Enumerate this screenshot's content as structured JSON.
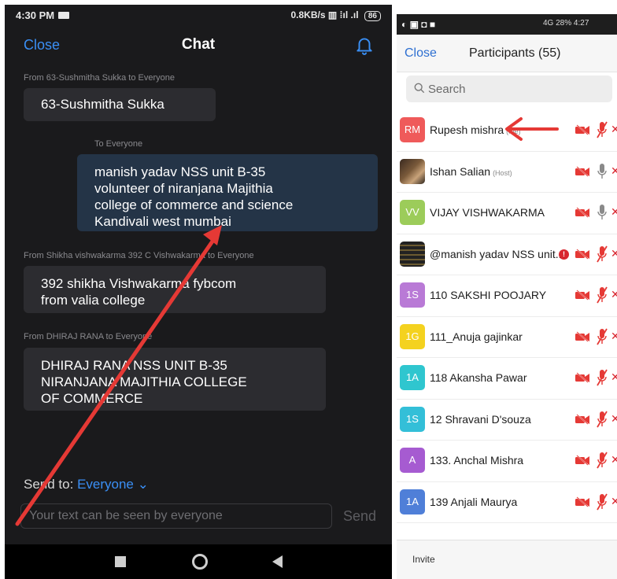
{
  "chat": {
    "status": {
      "time": "4:30 PM",
      "network": "0.8KB/s",
      "battery": "86"
    },
    "header": {
      "close": "Close",
      "title": "Chat"
    },
    "messages": [
      {
        "meta": "From 63-Sushmitha Sukka to Everyone",
        "text": "63-Sushmitha Sukka"
      },
      {
        "meta": "To Everyone",
        "lines": [
          "manish yadav NSS unit B-35",
          "volunteer of niranjana Majithia",
          "college of commerce and science",
          "Kandivali west mumbai"
        ]
      },
      {
        "meta": "From Shikha vishwakarma 392 C Vishwakarma to Everyone",
        "lines": [
          "392 shikha Vishwakarma fybcom",
          "from valia college"
        ]
      },
      {
        "meta": "From DHIRAJ RANA to Everyone",
        "lines": [
          "DHIRAJ RANA NSS UNIT B-35",
          "NIRANJANA MAJITHIA COLLEGE",
          "OF COMMERCE"
        ]
      }
    ],
    "send_to": {
      "label": "Send to:",
      "target": "Everyone"
    },
    "input": {
      "placeholder": "Your text can be seen by everyone",
      "value": ""
    },
    "send": "Send"
  },
  "participants": {
    "status": {
      "right": "4G 28% 4:27"
    },
    "header": {
      "close": "Close",
      "title": "Participants (55)"
    },
    "search": {
      "placeholder": "Search"
    },
    "rows": [
      {
        "initials": "RM",
        "name": "Rupesh mishra",
        "tag": "(me)",
        "avatar_color": "#ef5a5a",
        "mic": "muted"
      },
      {
        "initials": "",
        "name": "Ishan Salian",
        "tag": "(Host)",
        "avatar_color": "photo1",
        "mic": "on"
      },
      {
        "initials": "VV",
        "name": "VIJAY VISHWAKARMA",
        "tag": "",
        "avatar_color": "#9ccc5a",
        "mic": "on"
      },
      {
        "initials": "",
        "name": "@manish yadav NSS unit...",
        "tag": "",
        "avatar_color": "photo2",
        "mic": "muted",
        "alert": "!"
      },
      {
        "initials": "1S",
        "name": "110 SAKSHI POOJARY",
        "tag": "",
        "avatar_color": "#b97ad6",
        "mic": "muted"
      },
      {
        "initials": "1G",
        "name": "111_Anuja gajinkar",
        "tag": "",
        "avatar_color": "#f4d21f",
        "mic": "muted"
      },
      {
        "initials": "1A",
        "name": "118 Akansha Pawar",
        "tag": "",
        "avatar_color": "#2fc6cf",
        "mic": "muted"
      },
      {
        "initials": "1S",
        "name": "12 Shravani D'souza",
        "tag": "",
        "avatar_color": "#33bfd8",
        "mic": "muted"
      },
      {
        "initials": "A",
        "name": "133. Anchal Mishra",
        "tag": "",
        "avatar_color": "#a65bd1",
        "mic": "muted"
      },
      {
        "initials": "1A",
        "name": "139 Anjali Maurya",
        "tag": "",
        "avatar_color": "#4f7fd8",
        "mic": "muted"
      }
    ],
    "invite": "Invite"
  },
  "colors": {
    "accent_blue": "#3a8ff5",
    "annotation_red": "#e53935",
    "chat_bg": "#1a1a1c"
  }
}
